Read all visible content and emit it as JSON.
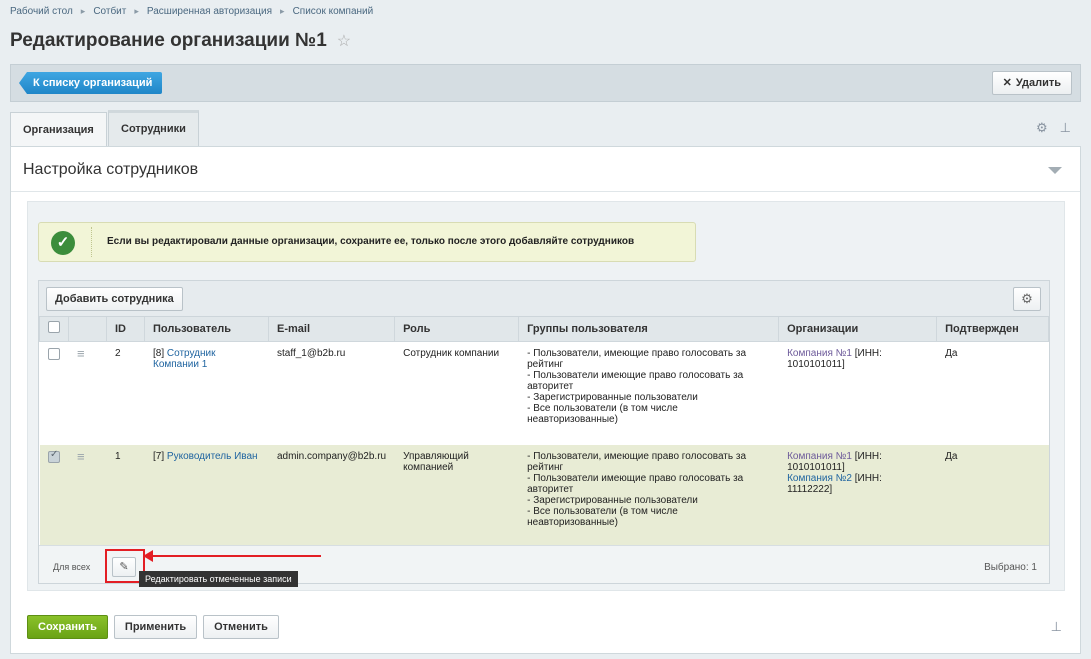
{
  "breadcrumb": [
    "Рабочий стол",
    "Сотбит",
    "Расширенная авторизация",
    "Список компаний"
  ],
  "page": {
    "title": "Редактирование организации №1",
    "star": "☆"
  },
  "toolbar": {
    "back_label": "К списку организаций",
    "delete_label": "Удалить",
    "delete_x": "✕"
  },
  "tabs": [
    {
      "label": "Организация"
    },
    {
      "label": "Сотрудники"
    }
  ],
  "tab_tools": {
    "settings": "⚙",
    "pin": "⊥"
  },
  "section": {
    "title": "Настройка сотрудников"
  },
  "notice": {
    "icon": "✓",
    "text": "Если вы редактировали данные организации, сохраните ее, только после этого добавляйте сотрудников"
  },
  "grid": {
    "add_label": "Добавить сотрудника",
    "gear": "⚙",
    "columns": [
      "ID",
      "Пользователь",
      "E-mail",
      "Роль",
      "Группы пользователя",
      "Организации",
      "Подтвержден"
    ],
    "rows": [
      {
        "checked": false,
        "drag": "≡",
        "id": "2",
        "user_prefix": "[8]",
        "user_name": "Сотрудник Компании 1",
        "email": "staff_1@b2b.ru",
        "role": "Сотрудник компании",
        "groups": [
          "- Пользователи, имеющие право голосовать за рейтинг",
          "- Пользователи имеющие право голосовать за авторитет",
          "- Зарегистрированные пользователи",
          "- Все пользователи (в том числе неавторизованные)"
        ],
        "orgs": [
          {
            "name": "Компания №1",
            "inn": " [ИНН: 1010101011]"
          }
        ],
        "confirmed": "Да"
      },
      {
        "checked": true,
        "drag": "≡",
        "id": "1",
        "user_prefix": "[7]",
        "user_name": "Руководитель Иван",
        "email": "admin.company@b2b.ru",
        "role": "Управляющий компанией",
        "groups": [
          "- Пользователи, имеющие право голосовать за рейтинг",
          "- Пользователи имеющие право голосовать за авторитет",
          "- Зарегистрированные пользователи",
          "- Все пользователи (в том числе неавторизованные)"
        ],
        "orgs": [
          {
            "name": "Компания №1",
            "inn": " [ИНН: 1010101011]"
          },
          {
            "name": "Компания №2",
            "inn": " [ИНН: 11112222]"
          }
        ],
        "confirmed": "Да"
      }
    ],
    "footer": {
      "for_all": "Для всех",
      "edit_icon": "✎",
      "tooltip": "Редактировать отмеченные записи",
      "selected": "Выбрано: 1"
    }
  },
  "actions": {
    "save": "Сохранить",
    "apply": "Применить",
    "cancel": "Отменить",
    "pin": "⊥"
  },
  "colors": {
    "accent_blue": "#1f86c8",
    "save_green": "#6aa315",
    "highlight_red": "#e31e24"
  }
}
